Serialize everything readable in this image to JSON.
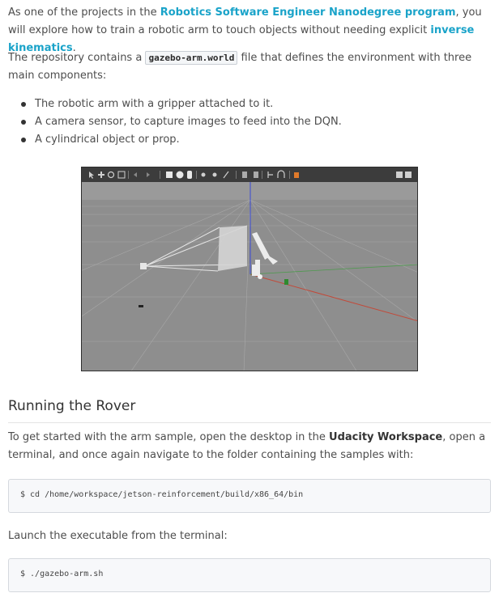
{
  "intro": {
    "text_before_link": "As one of the projects in the ",
    "link1": "Robotics Software Engineer Nanodegree program",
    "text_mid": ", you will explore how to train a robotic arm to touch objects without needing explicit ",
    "link2": "inverse kinematics",
    "text_end": "."
  },
  "repo": {
    "text_before": "The repository contains a ",
    "filename": "gazebo-arm.world",
    "text_after": " file that defines the environment with three main components:"
  },
  "components": [
    "The robotic arm with a gripper attached to it.",
    "A camera sensor, to capture images to feed into the DQN.",
    "A cylindrical object or prop."
  ],
  "section": {
    "title": "Running the Rover"
  },
  "start": {
    "text_before": "To get started with the arm sample, open the desktop in the ",
    "workspace": "Udacity Workspace",
    "text_after": ", open a terminal, and once again navigate to the folder containing the samples with:"
  },
  "commands": {
    "cd": "$ cd /home/workspace/jetson-reinforcement/build/x86_64/bin",
    "launch_text": "Launch the executable from the terminal:",
    "run": "$ ./gazebo-arm.sh"
  },
  "colors": {
    "link": "#1aa3c9",
    "sim_floor": "#8a8a8a",
    "sim_toolbar": "#3c3c3c"
  }
}
